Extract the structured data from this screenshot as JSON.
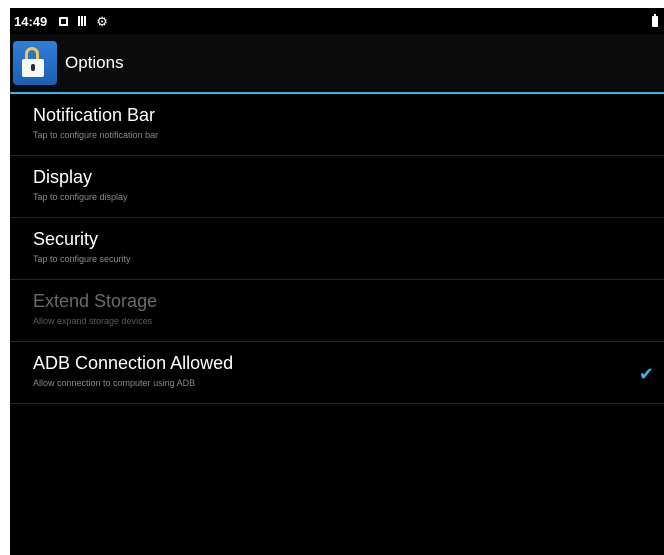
{
  "statusbar": {
    "time": "14:49",
    "icons": [
      "notification-square-icon",
      "signal-bars-icon",
      "settings-gear-icon",
      "battery-icon"
    ]
  },
  "actionbar": {
    "app_icon": "lock-icon",
    "title": "Options",
    "accent_color": "#33b5e5"
  },
  "items": [
    {
      "title": "Notification Bar",
      "subtitle": "Tap to configure notification bar",
      "enabled": true
    },
    {
      "title": "Display",
      "subtitle": "Tap to configure display",
      "enabled": true
    },
    {
      "title": "Security",
      "subtitle": "Tap to configure security",
      "enabled": true
    },
    {
      "title": "Extend Storage",
      "subtitle": "Allow expand storage devices",
      "enabled": false
    },
    {
      "title": "ADB Connection Allowed",
      "subtitle": "Allow connection to computer using ADB",
      "enabled": true,
      "checked": true
    }
  ]
}
